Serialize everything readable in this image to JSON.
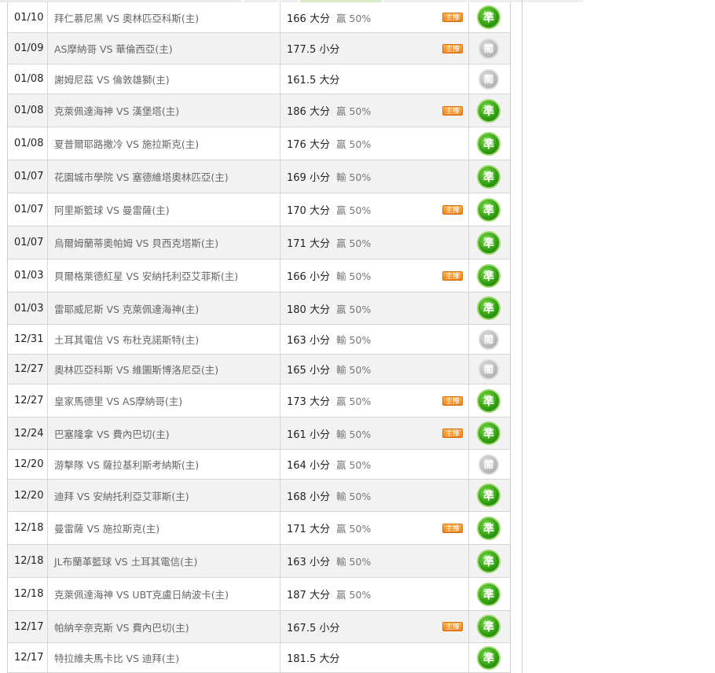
{
  "rows": [
    {
      "date": "01/10",
      "match": "拜仁慕尼黑 VS 奧林匹亞科斯(主)",
      "pick": "166 大分",
      "result": "贏 50%",
      "badge": "主推",
      "status": "準",
      "win": true
    },
    {
      "date": "01/09",
      "match": "AS摩納哥 VS 華倫西亞(主)",
      "pick": "177.5 小分",
      "result": "",
      "badge": "主推",
      "status": "閤",
      "win": false
    },
    {
      "date": "01/08",
      "match": "謝姆尼茲 VS 倫敦雄獅(主)",
      "pick": "161.5 大分",
      "result": "",
      "badge": "",
      "status": "閤",
      "win": false
    },
    {
      "date": "01/08",
      "match": "克萊佩達海神 VS 漢堡塔(主)",
      "pick": "186 大分",
      "result": "贏 50%",
      "badge": "主推",
      "status": "準",
      "win": true
    },
    {
      "date": "01/08",
      "match": "夏普爾耶路撒冷 VS 施拉斯克(主)",
      "pick": "176 大分",
      "result": "贏 50%",
      "badge": "",
      "status": "準",
      "win": true
    },
    {
      "date": "01/07",
      "match": "花園城市學院 VS 塞德維塔奧林匹亞(主)",
      "pick": "169 小分",
      "result": "輸 50%",
      "badge": "",
      "status": "準",
      "win": true
    },
    {
      "date": "01/07",
      "match": "阿里斯籃球 VS 曼雷薩(主)",
      "pick": "170 大分",
      "result": "贏 50%",
      "badge": "主推",
      "status": "準",
      "win": true
    },
    {
      "date": "01/07",
      "match": "烏爾姆蘭蒂奧帕姆 VS 貝西克塔斯(主)",
      "pick": "171 大分",
      "result": "贏 50%",
      "badge": "",
      "status": "準",
      "win": true
    },
    {
      "date": "01/03",
      "match": "貝爾格萊德紅星 VS 安納托利亞艾菲斯(主)",
      "pick": "166 小分",
      "result": "輸 50%",
      "badge": "主推",
      "status": "準",
      "win": true
    },
    {
      "date": "01/03",
      "match": "雷耶威尼斯 VS 克萊佩達海神(主)",
      "pick": "180 大分",
      "result": "贏 50%",
      "badge": "",
      "status": "準",
      "win": true
    },
    {
      "date": "12/31",
      "match": "土耳其電信 VS 布杜克諾斯特(主)",
      "pick": "163 小分",
      "result": "輸 50%",
      "badge": "",
      "status": "閤",
      "win": false
    },
    {
      "date": "12/27",
      "match": "奧林匹亞科斯 VS 維圖斯博洛尼亞(主)",
      "pick": "165 小分",
      "result": "輸 50%",
      "badge": "",
      "status": "閤",
      "win": false
    },
    {
      "date": "12/27",
      "match": "皇家馬德里 VS AS摩納哥(主)",
      "pick": "173 大分",
      "result": "贏 50%",
      "badge": "主推",
      "status": "準",
      "win": true
    },
    {
      "date": "12/24",
      "match": "巴塞隆拿 VS 費內巴切(主)",
      "pick": "161 小分",
      "result": "輸 50%",
      "badge": "主推",
      "status": "準",
      "win": true
    },
    {
      "date": "12/20",
      "match": "游擊隊 VS 薩拉基利斯考納斯(主)",
      "pick": "164 小分",
      "result": "贏 50%",
      "badge": "",
      "status": "閤",
      "win": false
    },
    {
      "date": "12/20",
      "match": "迪拜 VS 安納托利亞艾菲斯(主)",
      "pick": "168 小分",
      "result": "輸 50%",
      "badge": "",
      "status": "準",
      "win": true
    },
    {
      "date": "12/18",
      "match": "曼雷薩 VS 施拉斯克(主)",
      "pick": "171 大分",
      "result": "贏 50%",
      "badge": "主推",
      "status": "準",
      "win": true
    },
    {
      "date": "12/18",
      "match": "JL布蘭革籃球 VS 土耳其電信(主)",
      "pick": "163 小分",
      "result": "輸 50%",
      "badge": "",
      "status": "準",
      "win": true
    },
    {
      "date": "12/18",
      "match": "克萊佩達海神 VS UBT克盧日納波卡(主)",
      "pick": "187 大分",
      "result": "贏 50%",
      "badge": "",
      "status": "準",
      "win": true
    },
    {
      "date": "12/17",
      "match": "帕納辛奈克斯 VS 費內巴切(主)",
      "pick": "167.5 小分",
      "result": "",
      "badge": "主推",
      "status": "準",
      "win": true
    },
    {
      "date": "12/17",
      "match": "特拉維夫馬卡比 VS 迪拜(主)",
      "pick": "181.5 大分",
      "result": "",
      "badge": "",
      "status": "準",
      "win": true
    }
  ]
}
